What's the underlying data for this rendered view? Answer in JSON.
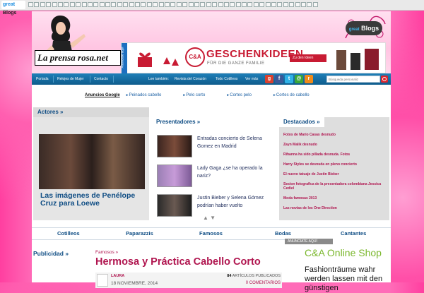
{
  "toolbar": {
    "logo_main": "Blogs",
    "logo_accent": "great"
  },
  "header": {
    "site_logo": "La prensa rosa.net",
    "great_badge_main": "Blogs",
    "great_badge_accent": "great"
  },
  "banner": {
    "tag": "Anunciate aquí",
    "brand": "C&A",
    "headline": "GESCHENKIDEEN",
    "subline": "FÜR DIE GANZE FAMILIE",
    "cta": "Zu den Ideen"
  },
  "nav": {
    "items": [
      "Portada",
      "Relojes de Mujer",
      "Contacto"
    ],
    "links": [
      "Lee también:",
      "Revista del Corazón",
      "Todo Cotilleos",
      "Ver más"
    ],
    "search_placeholder": "Búsqueda personaliz"
  },
  "ads_row": {
    "label": "Anuncios Google",
    "links": [
      "Peinados cabello",
      "Pelo corto",
      "Cortes pelo",
      "Cortes de cabello"
    ]
  },
  "actores": {
    "title": "Actores »",
    "caption": "Las imágenes de Penélope Cruz para Loewe"
  },
  "presentadores": {
    "title": "Presentadores »",
    "items": [
      "Entradas concierto de Selena Gomez en Madrid",
      "Lady Gaga ¿se ha operado la nariz?",
      "Justin Bieber y Selena Gómez podrían haber vuelto"
    ]
  },
  "destacados": {
    "title": "Destacados »",
    "items": [
      "Fotos de Mario Casas desnudo",
      "Zayn Malik desnudo",
      "Rihanna ha sido pillada desnuda. Fotos",
      "Harry Styles se desnuda en pleno concierto",
      "El nuevo tatuaje de Justin Bieber",
      "Sesion fotografica de la presentadora colombiana Jessica Cediel",
      "Moda famosas 2013",
      "Las novias de los One Direction"
    ]
  },
  "categories": [
    "Cotilleos",
    "Paparazzis",
    "Famosos",
    "Bodas",
    "Cantantes"
  ],
  "publicidad": {
    "title": "Publicidad »"
  },
  "post": {
    "category": "Famosos »",
    "title": "Hermosa y Práctica Cabello Corto",
    "author": "LAURA",
    "date": "18 NOVIEMBRE, 2014",
    "articles_count": "84",
    "articles_label": "ARTÍCULOS PUBLICADOS",
    "comments": "0 COMENTARIOS"
  },
  "side_ad": {
    "label": "ANUNCIATE AQUÍ",
    "title": "C&A Online Shop",
    "text": "Fashionträume wahr werden lassen mit den günstigen"
  },
  "colors": {
    "pink_bg": "#ff6cb8",
    "nav_blue": "#1f7fb8",
    "accent_red": "#c81b33",
    "title_pink": "#b0154f"
  }
}
